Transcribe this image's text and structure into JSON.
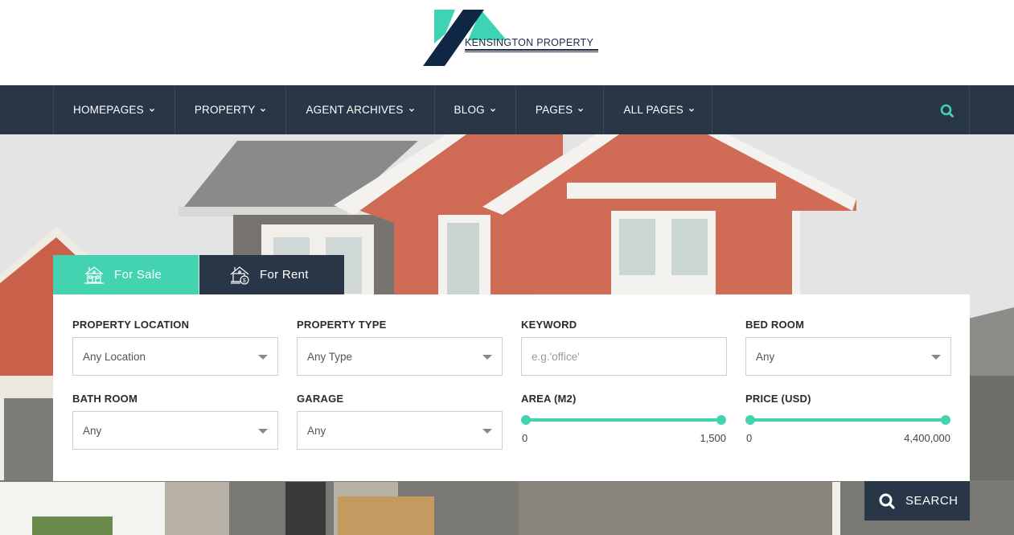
{
  "brand": {
    "name": "KENSINGTON PROPERTY",
    "colors": {
      "accent": "#43d3b0",
      "navy": "#283647",
      "logo_dark": "#1b2a44"
    }
  },
  "nav": {
    "items": [
      {
        "label": "HOMEPAGES",
        "icon": "chevron-down-icon"
      },
      {
        "label": "PROPERTY",
        "icon": "chevron-down-icon"
      },
      {
        "label": "AGENT ARCHIVES",
        "icon": "chevron-down-icon"
      },
      {
        "label": "BLOG",
        "icon": "chevron-down-icon"
      },
      {
        "label": "PAGES",
        "icon": "chevron-down-icon"
      },
      {
        "label": "ALL PAGES",
        "icon": "chevron-down-icon"
      }
    ],
    "search_icon": "search-icon"
  },
  "tabs": [
    {
      "label": "For Sale",
      "icon": "house-icon",
      "active": true
    },
    {
      "label": "For Rent",
      "icon": "house-dollar-icon",
      "active": false
    }
  ],
  "search": {
    "fields": {
      "location": {
        "label": "PROPERTY LOCATION",
        "value": "Any Location"
      },
      "type": {
        "label": "PROPERTY TYPE",
        "value": "Any Type"
      },
      "keyword": {
        "label": "KEYWORD",
        "value": "",
        "placeholder": "e.g.'office'"
      },
      "bedroom": {
        "label": "BED ROOM",
        "value": "Any"
      },
      "bathroom": {
        "label": "BATH ROOM",
        "value": "Any"
      },
      "garage": {
        "label": "GARAGE",
        "value": "Any"
      }
    },
    "ranges": {
      "area": {
        "label": "AREA (M2)",
        "min": "0",
        "max": "1,500",
        "low_fraction": 0,
        "high_fraction": 1
      },
      "price": {
        "label": "PRICE (USD)",
        "min": "0",
        "max": "4,400,000",
        "low_fraction": 0,
        "high_fraction": 1
      }
    },
    "button_label": "SEARCH"
  }
}
